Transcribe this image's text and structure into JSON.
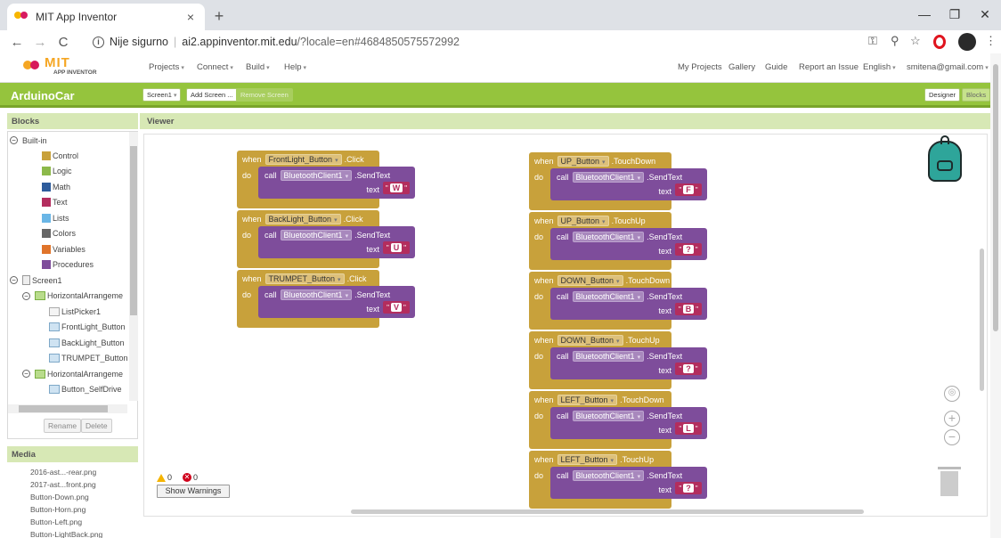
{
  "browser": {
    "tab_title": "MIT App Inventor",
    "tab_close": "×",
    "new_tab": "+",
    "win_min": "—",
    "win_max": "❐",
    "win_close": "✕",
    "back": "←",
    "forward": "→",
    "reload": "C",
    "not_secure": "Nije sigurno",
    "url_host": "ai2.appinventor.mit.edu",
    "url_rest": "/?locale=en#4684850575572992"
  },
  "header": {
    "logo_text": "MIT",
    "logo_sub": "APP INVENTOR",
    "menus": [
      "Projects",
      "Connect",
      "Build",
      "Help"
    ],
    "right_links": [
      "My Projects",
      "Gallery",
      "Guide",
      "Report an Issue",
      "English",
      "smitena@gmail.com"
    ]
  },
  "project_bar": {
    "project_name": "ArduinoCar",
    "screen_select": "Screen1",
    "add_screen": "Add Screen ...",
    "remove_screen": "Remove Screen",
    "designer": "Designer",
    "blocks": "Blocks"
  },
  "blocks_panel": {
    "title": "Blocks",
    "builtin": "Built-in",
    "builtin_items": [
      {
        "label": "Control",
        "color": "#c8a13b"
      },
      {
        "label": "Logic",
        "color": "#8cb94a"
      },
      {
        "label": "Math",
        "color": "#2e5c9c"
      },
      {
        "label": "Text",
        "color": "#b32d5e"
      },
      {
        "label": "Lists",
        "color": "#6ab6e6"
      },
      {
        "label": "Colors",
        "color": "#666666"
      },
      {
        "label": "Variables",
        "color": "#e0742a"
      },
      {
        "label": "Procedures",
        "color": "#7e4d9b"
      }
    ],
    "components": [
      "Screen1",
      "HorizontalArrangeme",
      "ListPicker1",
      "FrontLight_Button",
      "BackLight_Button",
      "TRUMPET_Button",
      "HorizontalArrangeme",
      "Button_SelfDrive",
      "HorizontalArrangeme"
    ],
    "rename": "Rename",
    "delete": "Delete"
  },
  "media": {
    "title": "Media",
    "files": [
      "2016-ast...-rear.png",
      "2017-ast...front.png",
      "Button-Down.png",
      "Button-Horn.png",
      "Button-Left.png",
      "Button-LightBack.png"
    ]
  },
  "viewer": {
    "title": "Viewer",
    "kw_when": "when",
    "kw_do": "do",
    "kw_call": "call",
    "kw_text": "text",
    "method": ".SendText",
    "component": "BluetoothClient1",
    "quote": "\"",
    "left_blocks": [
      {
        "button": "FrontLight_Button",
        "event": ".Click",
        "value": "W"
      },
      {
        "button": "BackLight_Button",
        "event": ".Click",
        "value": "U"
      },
      {
        "button": "TRUMPET_Button",
        "event": ".Click",
        "value": "V"
      }
    ],
    "right_blocks": [
      {
        "button": "UP_Button",
        "event": ".TouchDown",
        "value": "F"
      },
      {
        "button": "UP_Button",
        "event": ".TouchUp",
        "value": "?"
      },
      {
        "button": "DOWN_Button",
        "event": ".TouchDown",
        "value": "B"
      },
      {
        "button": "DOWN_Button",
        "event": ".TouchUp",
        "value": "?"
      },
      {
        "button": "LEFT_Button",
        "event": ".TouchDown",
        "value": "L"
      },
      {
        "button": "LEFT_Button",
        "event": ".TouchUp",
        "value": "?"
      }
    ],
    "warnings_count": "0",
    "errors_count": "0",
    "show_warnings": "Show Warnings"
  }
}
